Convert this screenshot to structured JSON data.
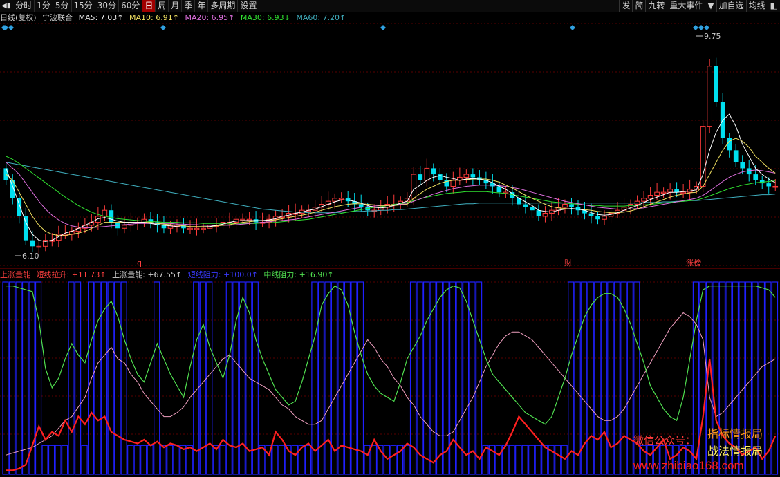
{
  "toolbar": {
    "play_icon": "play-prev-icon",
    "periods": [
      "分时",
      "1分",
      "5分",
      "15分",
      "30分",
      "60分",
      "日",
      "周",
      "月",
      "季",
      "年",
      "多周期",
      "设置"
    ],
    "active_period": "日",
    "right": [
      "发",
      "简",
      "九转",
      "重大事件",
      "▼",
      "加自选",
      "均线",
      "◧"
    ]
  },
  "header": {
    "chart_name": "日线(复权)",
    "stock": "宁波联合",
    "ma5": "MA5: 7.03↑",
    "ma10": "MA10: 6.91↑",
    "ma20": "MA20: 6.95↑",
    "ma30": "MA30: 6.93↓",
    "ma60": "MA60: 7.20↑"
  },
  "indicator_header": {
    "l1": "上涨量能",
    "l2": "短线拉升: +11.73↑",
    "l3": "上涨量能: +67.55↑",
    "l4": "短线阻力: +100.0↑",
    "l5": "中线阻力: +16.90↑"
  },
  "annotations": {
    "high": "9.75",
    "low": "6.10",
    "mark_q": "q",
    "mark_cai": "财",
    "mark_zhangbang": "涨榜"
  },
  "watermark": {
    "w1": "微信公众号：",
    "w2": "指标情报局",
    "w3": "战法情报局",
    "w4": "www.zhibiao168.com"
  },
  "colors": {
    "up": "#ff3b3b",
    "down": "#00e0f0",
    "ma5": "#ffffff",
    "ma10": "#f0e060",
    "ma20": "#e070e0",
    "ma30": "#30e030",
    "ma60": "#40b0c0",
    "blue": "#2020ff",
    "green": "#50e050",
    "pink": "#f0a0c0",
    "red": "#ff2020"
  },
  "chart_data": [
    {
      "type": "candlestick",
      "title": "日线(复权) 宁波联合",
      "y_range": [
        6.1,
        9.75
      ],
      "high": 9.75,
      "low": 6.1,
      "close": [
        7.3,
        7.0,
        6.7,
        6.3,
        6.2,
        6.2,
        6.3,
        6.3,
        6.4,
        6.4,
        6.45,
        6.5,
        6.55,
        6.6,
        6.7,
        6.8,
        6.6,
        6.5,
        6.55,
        6.6,
        6.6,
        6.65,
        6.6,
        6.55,
        6.5,
        6.55,
        6.55,
        6.5,
        6.5,
        6.5,
        6.5,
        6.55,
        6.55,
        6.6,
        6.6,
        6.65,
        6.65,
        6.65,
        6.6,
        6.6,
        6.65,
        6.7,
        6.7,
        6.75,
        6.75,
        6.8,
        6.8,
        6.85,
        6.9,
        6.95,
        7.0,
        7.0,
        6.95,
        6.9,
        6.85,
        6.8,
        6.8,
        6.85,
        6.9,
        6.9,
        6.95,
        7.0,
        7.4,
        7.3,
        7.5,
        7.4,
        7.3,
        7.2,
        7.3,
        7.35,
        7.4,
        7.35,
        7.3,
        7.25,
        7.2,
        7.1,
        7.1,
        7.0,
        6.9,
        6.85,
        6.8,
        6.7,
        6.75,
        6.8,
        6.85,
        6.9,
        6.85,
        6.8,
        6.75,
        6.7,
        6.65,
        6.7,
        6.75,
        6.8,
        6.85,
        6.9,
        6.95,
        7.0,
        7.05,
        7.1,
        7.1,
        7.15,
        7.1,
        7.1,
        7.15,
        7.2,
        8.2,
        9.2,
        8.6,
        8.0,
        7.8,
        7.6,
        7.5,
        7.4,
        7.3,
        7.25,
        7.2,
        7.2
      ],
      "ma5": [
        7.5,
        7.2,
        6.9,
        6.6,
        6.4,
        6.3,
        6.28,
        6.3,
        6.36,
        6.42,
        6.45,
        6.5,
        6.55,
        6.6,
        6.66,
        6.68,
        6.65,
        6.62,
        6.6,
        6.6,
        6.6,
        6.6,
        6.58,
        6.56,
        6.55,
        6.54,
        6.53,
        6.52,
        6.52,
        6.52,
        6.52,
        6.53,
        6.55,
        6.57,
        6.6,
        6.62,
        6.63,
        6.63,
        6.63,
        6.63,
        6.64,
        6.66,
        6.7,
        6.72,
        6.75,
        6.77,
        6.8,
        6.82,
        6.86,
        6.9,
        6.94,
        6.97,
        6.97,
        6.95,
        6.92,
        6.88,
        6.85,
        6.84,
        6.85,
        6.88,
        6.92,
        6.95,
        7.15,
        7.22,
        7.3,
        7.35,
        7.38,
        7.35,
        7.33,
        7.3,
        7.32,
        7.33,
        7.32,
        7.3,
        7.26,
        7.2,
        7.15,
        7.08,
        7.0,
        6.94,
        6.88,
        6.8,
        6.78,
        6.77,
        6.8,
        6.82,
        6.83,
        6.82,
        6.8,
        6.76,
        6.73,
        6.72,
        6.73,
        6.76,
        6.8,
        6.84,
        6.88,
        6.93,
        6.98,
        7.02,
        7.06,
        7.1,
        7.1,
        7.11,
        7.12,
        7.14,
        7.4,
        7.8,
        8.1,
        8.3,
        8.4,
        8.2,
        7.9,
        7.7,
        7.5,
        7.4,
        7.32,
        7.26
      ],
      "ma10": [
        7.4,
        7.3,
        7.1,
        6.9,
        6.7,
        6.55,
        6.45,
        6.4,
        6.38,
        6.38,
        6.4,
        6.42,
        6.45,
        6.5,
        6.55,
        6.6,
        6.6,
        6.6,
        6.6,
        6.6,
        6.6,
        6.6,
        6.6,
        6.58,
        6.57,
        6.56,
        6.55,
        6.54,
        6.53,
        6.53,
        6.53,
        6.53,
        6.54,
        6.55,
        6.56,
        6.58,
        6.6,
        6.61,
        6.62,
        6.63,
        6.63,
        6.64,
        6.66,
        6.68,
        6.7,
        6.72,
        6.74,
        6.77,
        6.8,
        6.83,
        6.86,
        6.88,
        6.9,
        6.91,
        6.91,
        6.9,
        6.89,
        6.88,
        6.88,
        6.88,
        6.89,
        6.9,
        7.0,
        7.08,
        7.15,
        7.2,
        7.25,
        7.28,
        7.3,
        7.3,
        7.31,
        7.32,
        7.32,
        7.32,
        7.3,
        7.27,
        7.22,
        7.17,
        7.11,
        7.05,
        7.0,
        6.95,
        6.9,
        6.86,
        6.84,
        6.83,
        6.82,
        6.82,
        6.81,
        6.8,
        6.78,
        6.77,
        6.76,
        6.76,
        6.77,
        6.79,
        6.82,
        6.86,
        6.9,
        6.94,
        6.98,
        7.02,
        7.05,
        7.07,
        7.09,
        7.1,
        7.2,
        7.4,
        7.6,
        7.8,
        7.95,
        8.0,
        7.95,
        7.85,
        7.7,
        7.6,
        7.5,
        7.42
      ],
      "ma20": [
        7.6,
        7.5,
        7.4,
        7.25,
        7.1,
        6.95,
        6.82,
        6.72,
        6.64,
        6.58,
        6.54,
        6.52,
        6.51,
        6.51,
        6.52,
        6.53,
        6.54,
        6.55,
        6.56,
        6.57,
        6.58,
        6.58,
        6.58,
        6.58,
        6.58,
        6.58,
        6.57,
        6.57,
        6.56,
        6.56,
        6.55,
        6.55,
        6.55,
        6.55,
        6.55,
        6.56,
        6.57,
        6.58,
        6.59,
        6.6,
        6.61,
        6.62,
        6.63,
        6.64,
        6.65,
        6.67,
        6.69,
        6.71,
        6.73,
        6.75,
        6.77,
        6.79,
        6.81,
        6.83,
        6.85,
        6.86,
        6.87,
        6.88,
        6.88,
        6.89,
        6.9,
        6.91,
        6.95,
        6.99,
        7.03,
        7.07,
        7.1,
        7.13,
        7.16,
        7.18,
        7.2,
        7.21,
        7.22,
        7.22,
        7.22,
        7.21,
        7.2,
        7.18,
        7.16,
        7.13,
        7.1,
        7.07,
        7.04,
        7.01,
        6.98,
        6.95,
        6.93,
        6.91,
        6.89,
        6.87,
        6.85,
        6.84,
        6.83,
        6.82,
        6.82,
        6.82,
        6.83,
        6.84,
        6.86,
        6.88,
        6.9,
        6.92,
        6.94,
        6.96,
        6.98,
        7.0,
        7.05,
        7.12,
        7.2,
        7.28,
        7.35,
        7.4,
        7.44,
        7.46,
        7.47,
        7.46,
        7.44,
        7.42
      ],
      "ma30": [
        7.7,
        7.65,
        7.58,
        7.5,
        7.42,
        7.34,
        7.26,
        7.18,
        7.1,
        7.02,
        6.95,
        6.88,
        6.82,
        6.77,
        6.73,
        6.7,
        6.68,
        6.66,
        6.65,
        6.64,
        6.63,
        6.62,
        6.61,
        6.61,
        6.6,
        6.6,
        6.6,
        6.59,
        6.59,
        6.59,
        6.58,
        6.58,
        6.58,
        6.58,
        6.58,
        6.58,
        6.58,
        6.58,
        6.58,
        6.59,
        6.59,
        6.6,
        6.61,
        6.62,
        6.63,
        6.64,
        6.65,
        6.67,
        6.69,
        6.71,
        6.73,
        6.75,
        6.77,
        6.79,
        6.81,
        6.83,
        6.85,
        6.86,
        6.88,
        6.9,
        6.91,
        6.93,
        6.96,
        6.99,
        7.02,
        7.04,
        7.06,
        7.08,
        7.09,
        7.1,
        7.11,
        7.11,
        7.11,
        7.11,
        7.1,
        7.09,
        7.08,
        7.06,
        7.04,
        7.02,
        7.0,
        6.98,
        6.96,
        6.94,
        6.93,
        6.92,
        6.91,
        6.9,
        6.89,
        6.88,
        6.88,
        6.87,
        6.87,
        6.87,
        6.87,
        6.88,
        6.88,
        6.89,
        6.9,
        6.91,
        6.92,
        6.93,
        6.94,
        6.95,
        6.96,
        6.97,
        7.0,
        7.04,
        7.08,
        7.12,
        7.16,
        7.19,
        7.22,
        7.24,
        7.26,
        7.27,
        7.28,
        7.29
      ],
      "ma60": [
        7.6,
        7.58,
        7.56,
        7.54,
        7.52,
        7.5,
        7.48,
        7.46,
        7.44,
        7.42,
        7.4,
        7.38,
        7.36,
        7.34,
        7.32,
        7.3,
        7.28,
        7.26,
        7.24,
        7.22,
        7.2,
        7.18,
        7.16,
        7.14,
        7.12,
        7.1,
        7.08,
        7.06,
        7.04,
        7.02,
        7.0,
        6.98,
        6.96,
        6.94,
        6.92,
        6.9,
        6.88,
        6.86,
        6.84,
        6.82,
        6.81,
        6.8,
        6.79,
        6.78,
        6.77,
        6.77,
        6.76,
        6.76,
        6.76,
        6.76,
        6.76,
        6.77,
        6.77,
        6.78,
        6.78,
        6.79,
        6.79,
        6.8,
        6.8,
        6.81,
        6.81,
        6.82,
        6.83,
        6.84,
        6.85,
        6.86,
        6.87,
        6.88,
        6.89,
        6.9,
        6.91,
        6.91,
        6.92,
        6.92,
        6.92,
        6.92,
        6.92,
        6.92,
        6.92,
        6.92,
        6.92,
        6.92,
        6.92,
        6.92,
        6.92,
        6.92,
        6.92,
        6.92,
        6.92,
        6.92,
        6.92,
        6.92,
        6.92,
        6.92,
        6.92,
        6.92,
        6.92,
        6.93,
        6.93,
        6.93,
        6.94,
        6.94,
        6.95,
        6.95,
        6.96,
        6.96,
        6.97,
        6.98,
        6.99,
        7.0,
        7.01,
        7.02,
        7.03,
        7.04,
        7.05,
        7.06,
        7.06,
        7.07
      ]
    },
    {
      "type": "line",
      "title": "上涨量能",
      "y_range": [
        0,
        100
      ],
      "series": [
        {
          "name": "短线拉升",
          "values": [
            2,
            2,
            3,
            5,
            15,
            25,
            18,
            22,
            20,
            28,
            22,
            30,
            26,
            32,
            28,
            30,
            22,
            20,
            18,
            17,
            16,
            18,
            15,
            17,
            14,
            16,
            15,
            13,
            14,
            12,
            14,
            16,
            13,
            18,
            15,
            14,
            16,
            12,
            13,
            14,
            10,
            22,
            18,
            12,
            10,
            14,
            16,
            12,
            15,
            18,
            12,
            15,
            14,
            13,
            12,
            10,
            18,
            12,
            8,
            10,
            12,
            16,
            14,
            10,
            8,
            6,
            10,
            12,
            18,
            14,
            10,
            12,
            8,
            14,
            12,
            10,
            15,
            22,
            30,
            26,
            22,
            18,
            14,
            12,
            10,
            8,
            12,
            10,
            16,
            20,
            18,
            22,
            14,
            16,
            20,
            18,
            16,
            12,
            10,
            14,
            18,
            8,
            10,
            14,
            12,
            8,
            30,
            60,
            28,
            20,
            16,
            14,
            10,
            12,
            14,
            8,
            12,
            20
          ]
        },
        {
          "name": "上涨量能",
          "values": [
            10,
            11,
            12,
            13,
            14,
            16,
            18,
            20,
            24,
            28,
            30,
            35,
            40,
            50,
            58,
            62,
            66,
            60,
            58,
            52,
            48,
            42,
            38,
            34,
            30,
            30,
            32,
            35,
            40,
            44,
            48,
            52,
            56,
            60,
            62,
            58,
            54,
            50,
            48,
            46,
            44,
            40,
            36,
            34,
            30,
            28,
            26,
            26,
            28,
            34,
            40,
            46,
            52,
            58,
            64,
            70,
            66,
            60,
            56,
            50,
            46,
            40,
            36,
            30,
            26,
            22,
            20,
            20,
            22,
            28,
            34,
            40,
            48,
            56,
            62,
            68,
            72,
            74,
            74,
            72,
            70,
            66,
            62,
            58,
            54,
            50,
            46,
            42,
            38,
            34,
            30,
            28,
            28,
            30,
            34,
            40,
            46,
            52,
            58,
            64,
            70,
            76,
            80,
            84,
            82,
            78,
            70,
            40,
            30,
            32,
            36,
            40,
            44,
            48,
            52,
            56,
            58,
            60
          ]
        },
        {
          "name": "中线阻力",
          "values": [
            98,
            98,
            97,
            96,
            95,
            80,
            55,
            45,
            50,
            60,
            68,
            62,
            58,
            70,
            80,
            86,
            90,
            82,
            70,
            60,
            52,
            48,
            58,
            68,
            60,
            52,
            46,
            40,
            56,
            70,
            78,
            66,
            58,
            50,
            62,
            80,
            92,
            84,
            70,
            60,
            52,
            44,
            40,
            36,
            38,
            48,
            60,
            72,
            88,
            94,
            98,
            96,
            88,
            74,
            62,
            52,
            46,
            42,
            40,
            38,
            48,
            60,
            66,
            72,
            80,
            86,
            92,
            96,
            98,
            97,
            90,
            80,
            70,
            60,
            52,
            48,
            44,
            40,
            36,
            32,
            30,
            28,
            26,
            30,
            40,
            50,
            62,
            72,
            82,
            88,
            92,
            94,
            94,
            92,
            86,
            78,
            68,
            58,
            46,
            40,
            34,
            30,
            28,
            40,
            60,
            80,
            96,
            98,
            98,
            98,
            98,
            98,
            98,
            98,
            98,
            97,
            96,
            92
          ]
        }
      ]
    }
  ]
}
